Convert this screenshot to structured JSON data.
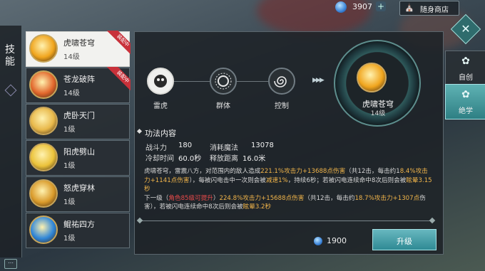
{
  "topbar": {
    "gem_icon": "blue-gem-icon",
    "gem_count": "3907",
    "add_label": "+",
    "shop_label": "随身商店",
    "close_icon": "close-icon"
  },
  "sidebar": {
    "title": "技能"
  },
  "skills": [
    {
      "name": "虎啸苍穹",
      "level": "14级",
      "badge": "装配中",
      "active": true,
      "icon_color": "#f0a51e"
    },
    {
      "name": "苍龙破阵",
      "level": "14级",
      "badge": "装配中",
      "active": false,
      "icon_color": "#e2672c"
    },
    {
      "name": "虎卧天门",
      "level": "1级",
      "badge": "",
      "active": false,
      "icon_color": "#e8b84a"
    },
    {
      "name": "阳虎劈山",
      "level": "1级",
      "badge": "",
      "active": false,
      "icon_color": "#ebc23a"
    },
    {
      "name": "怒虎穿林",
      "level": "1级",
      "badge": "",
      "active": false,
      "icon_color": "#d99a2a"
    },
    {
      "name": "鲲祐四方",
      "level": "1级",
      "badge": "",
      "active": false,
      "icon_color": "#2f86d8"
    }
  ],
  "attributes": [
    {
      "label": "雷虎",
      "icon": "tiger-head-icon"
    },
    {
      "label": "群体",
      "icon": "group-burst-icon"
    },
    {
      "label": "控制",
      "icon": "spiral-control-icon"
    }
  ],
  "selected_skill": {
    "name": "虎啸苍穹",
    "level": "14级"
  },
  "details": {
    "section_title": "功法内容",
    "stats": [
      {
        "label": "战斗力",
        "value": "180"
      },
      {
        "label": "消耗魔法",
        "value": "13078"
      },
      {
        "label": "冷却时间",
        "value": "60.0秒"
      },
      {
        "label": "释放距离",
        "value": "16.0米"
      }
    ],
    "desc_1": "虎啸苍穹，雷震八方，对范围内的敌人造成",
    "desc_1_hl": "221.1%攻击力+13688点伤害",
    "desc_2": "（共12击，每击约1",
    "desc_3_hl": "8.4%攻击力+1141点伤害",
    "desc_4": "），每被闪电击中一次则会被",
    "desc_4_hl": "减速1%",
    "desc_5": "，持续6秒；若被闪电连续命中8次后则会被",
    "desc_5_hl": "眩晕3.15秒",
    "next_label": "下一级（",
    "next_red": "角色85级可提升",
    "next_paren": "）",
    "next_hl": "224.8%攻击力+15688点伤害",
    "next_2": "（共12击，每击约",
    "next_2_hl": "18.7%攻击力+1307点",
    "next_3": "伤害），若被闪电连续命中8次后则会被",
    "next_3_hl": "眩晕3.2秒"
  },
  "upgrade": {
    "cost": "1900",
    "button_label": "升级"
  },
  "right_tabs": [
    {
      "label": "自创",
      "icon": "self-create-icon"
    },
    {
      "label": "绝学",
      "icon": "ultimate-icon"
    }
  ],
  "chat_icon": "chat-icon"
}
